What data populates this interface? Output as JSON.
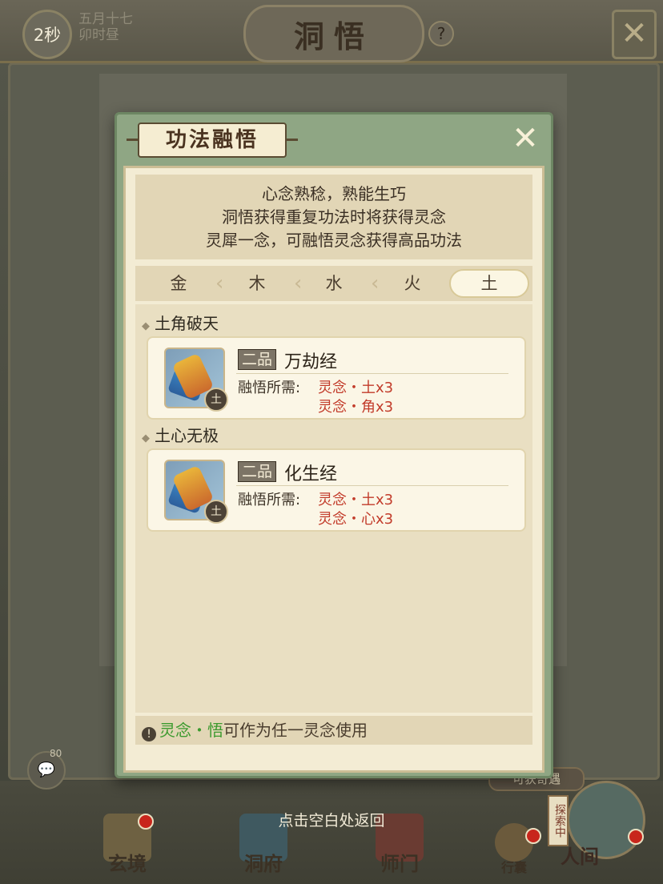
{
  "header": {
    "timer": "2秒",
    "date_line1": "五月十七",
    "date_line2": "卯时昼",
    "title": "洞悟",
    "help_icon": "question-icon",
    "close_icon": "close-x-icon"
  },
  "modal": {
    "title": "功法融悟",
    "close_icon": "close-x-icon",
    "intro": {
      "line1": "心念熟稔，熟能生巧",
      "line2": "洞悟获得重复功法时将获得灵念",
      "line3": "灵犀一念，可融悟灵念获得高品功法"
    },
    "tabs": [
      {
        "label": "金",
        "active": false
      },
      {
        "label": "木",
        "active": false
      },
      {
        "label": "水",
        "active": false
      },
      {
        "label": "火",
        "active": false
      },
      {
        "label": "土",
        "active": true
      }
    ],
    "sections": [
      {
        "title": "土角破天",
        "card": {
          "grade": "二品",
          "name": "万劫经",
          "element_badge": "土",
          "req_label": "融悟所需:",
          "req1": "灵念・土x3",
          "req2": "灵念・角x3"
        }
      },
      {
        "title": "土心无极",
        "card": {
          "grade": "二品",
          "name": "化生经",
          "element_badge": "土",
          "req_label": "融悟所需:",
          "req1": "灵念・土x3",
          "req2": "灵念・心x3"
        }
      }
    ],
    "footer": {
      "highlight": "灵念・悟",
      "text": "可作为任一灵念使用"
    }
  },
  "bottom": {
    "tap_return": "点击空白处返回",
    "chat_count": "80",
    "nav": [
      {
        "label": "玄境"
      },
      {
        "label": "洞府"
      },
      {
        "label": "师门"
      },
      {
        "label": "行囊"
      },
      {
        "label": "人间"
      }
    ],
    "encounter_badge": "可获奇遇",
    "explore_label": "探索中"
  },
  "colors": {
    "accent_red": "#c23b2a",
    "accent_green": "#3b9a2e",
    "modal_frame": "#8fa684",
    "parchment": "#f3ecd4"
  }
}
